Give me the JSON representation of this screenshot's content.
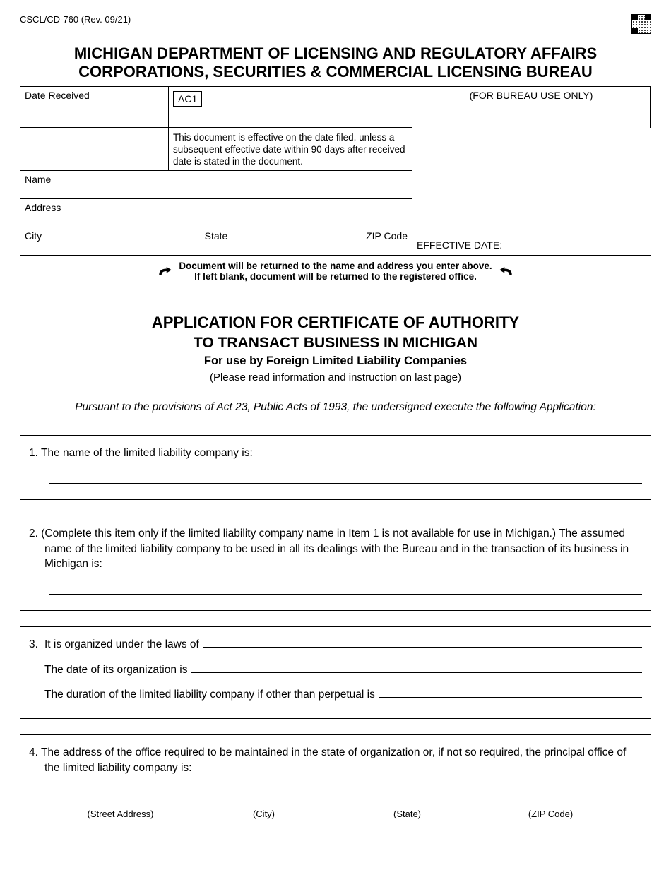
{
  "form_id": "CSCL/CD-760 (Rev. 09/21)",
  "agency_line1": "MICHIGAN DEPARTMENT OF LICENSING AND REGULATORY AFFAIRS",
  "agency_line2": "CORPORATIONS, SECURITIES & COMMERCIAL LICENSING BUREAU",
  "date_received_label": "Date Received",
  "bureau_only": "(FOR BUREAU USE ONLY)",
  "ac1": "AC1",
  "effective_note": "This document is effective on the date filed, unless a subsequent effective date within 90 days after received date is stated in the document.",
  "name_label": "Name",
  "address_label": "Address",
  "city_label": "City",
  "state_label": "State",
  "zip_label": "ZIP Code",
  "effective_date_label": "EFFECTIVE DATE:",
  "return_note_l1": "Document will be returned to the name and address you enter above.",
  "return_note_l2": "If left blank, document will be returned to the registered office.",
  "title_l1": "APPLICATION FOR CERTIFICATE OF AUTHORITY",
  "title_l2": "TO TRANSACT BUSINESS IN MICHIGAN",
  "title_l3": "For use by Foreign Limited Liability Companies",
  "title_l4": "(Please read information and instruction on last page)",
  "pursuant": "Pursuant to the provisions of Act 23, Public Acts of 1993, the undersigned execute the following Application:",
  "item1": "1.  The name of the limited liability company is:",
  "item2": "2.  (Complete this item only if the limited liability company name in Item 1 is not available for use in Michigan.) The assumed name of the limited liability company to be used in all its dealings with the Bureau and in the transaction of its business in Michigan is:",
  "item3_num": "3.",
  "item3_a": "It is organized under the laws of",
  "item3_b": "The date of its organization is",
  "item3_c": "The duration of the limited liability company if other than perpetual is",
  "item4": "4.  The address of the office required to be maintained in the state of organization or, if not so required, the principal office of the limited liability company is:",
  "addr_labels": {
    "street": "(Street Address)",
    "city": "(City)",
    "state": "(State)",
    "zip": "(ZIP Code)"
  }
}
